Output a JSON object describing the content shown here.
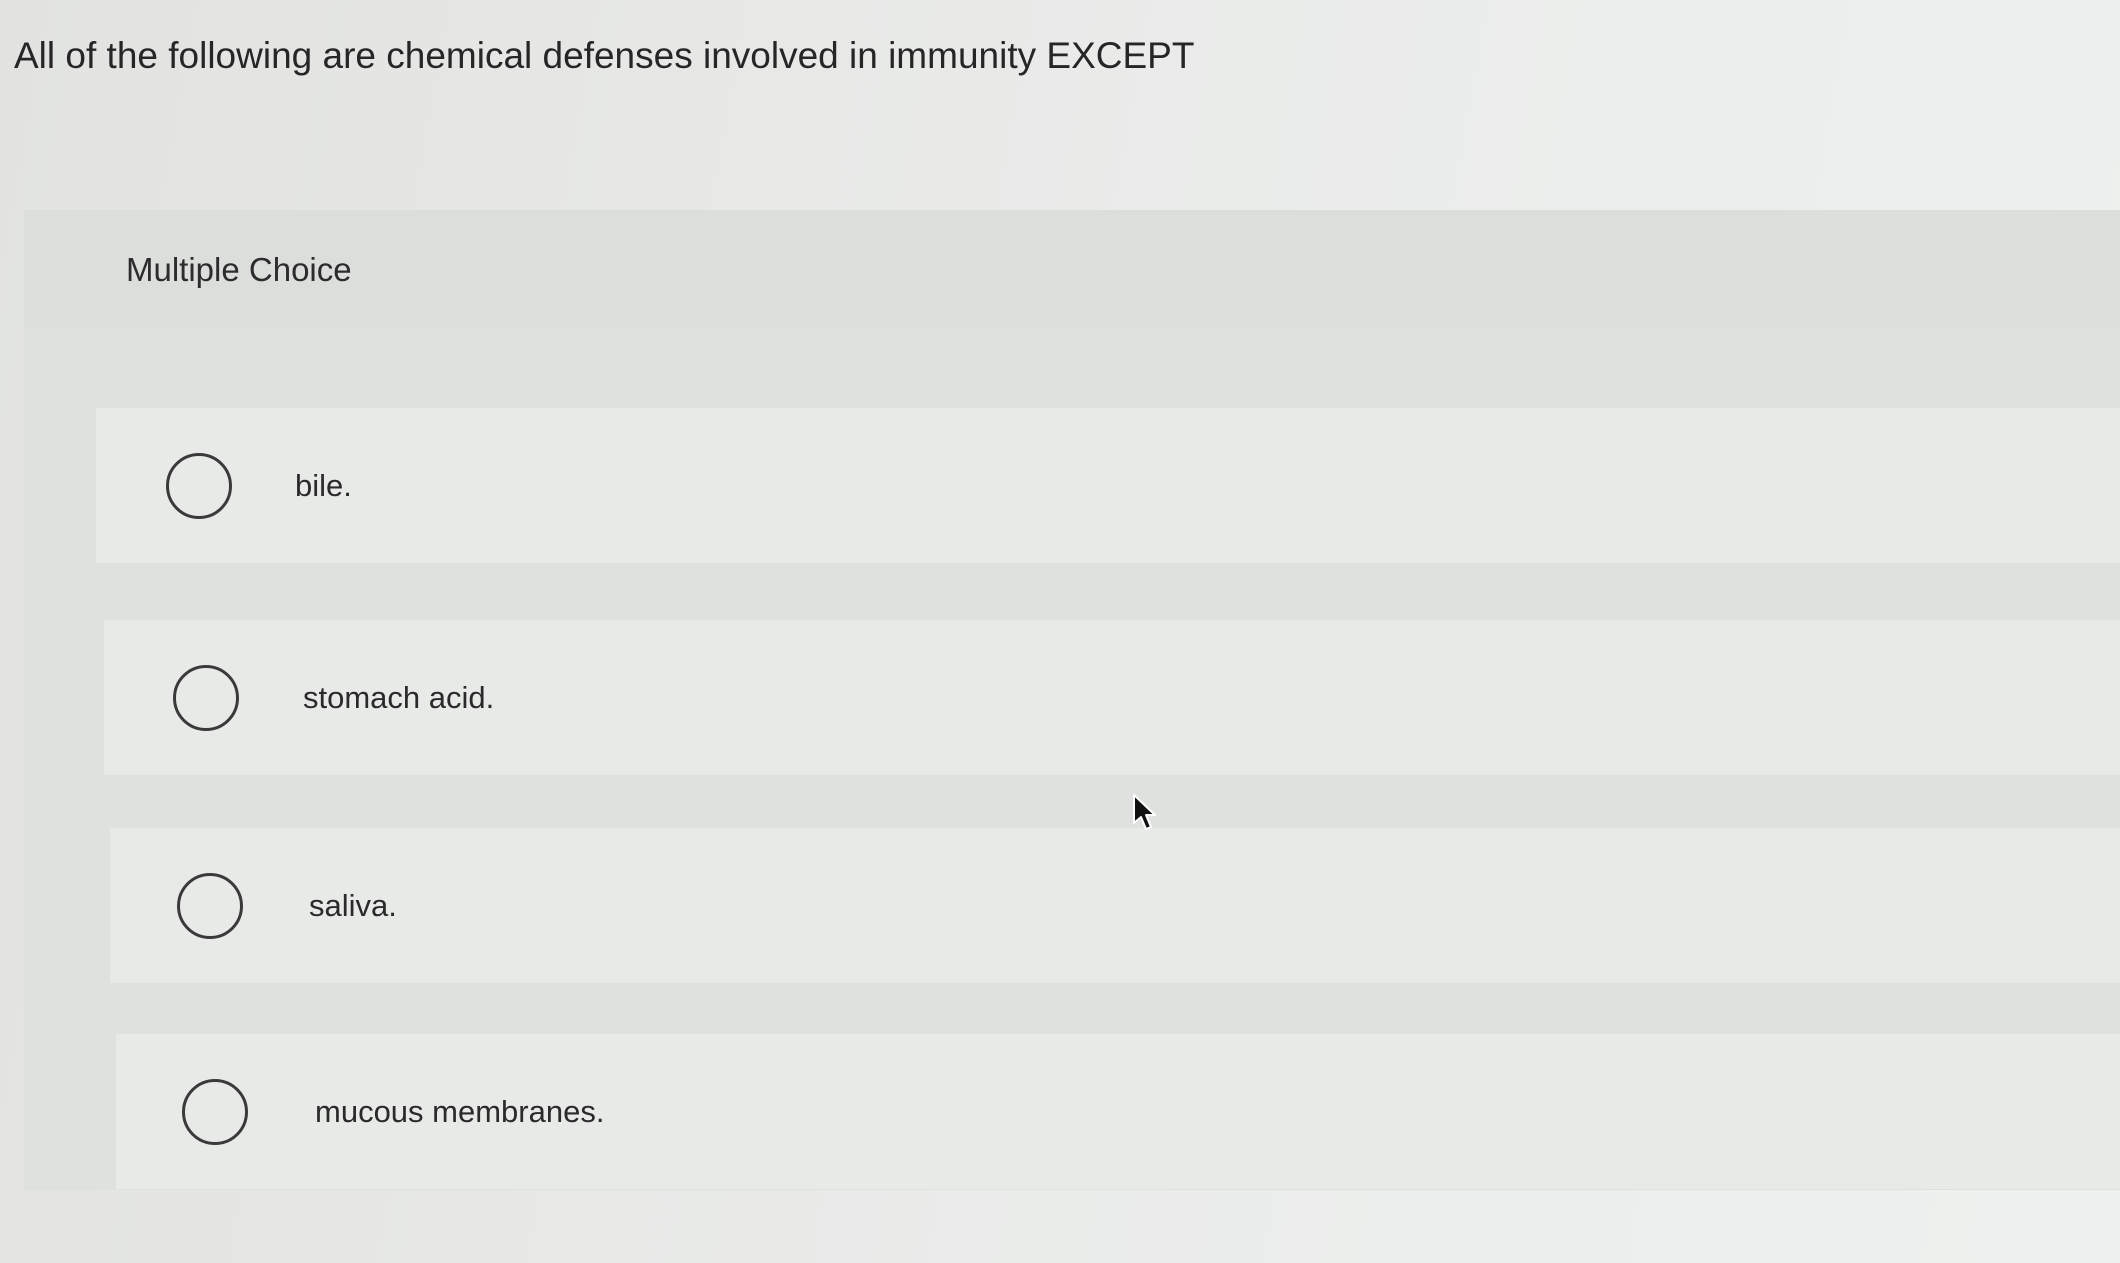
{
  "question": {
    "text": "All of the following are chemical defenses involved in immunity EXCEPT"
  },
  "choices_panel": {
    "label": "Multiple Choice",
    "options": [
      {
        "label": "bile.",
        "selected": false
      },
      {
        "label": "stomach acid.",
        "selected": false
      },
      {
        "label": "saliva.",
        "selected": false
      },
      {
        "label": "mucous membranes.",
        "selected": false
      }
    ]
  },
  "icons": {
    "radio": "radio-button-icon",
    "cursor": "mouse-pointer-icon"
  },
  "colors": {
    "text": "#262626",
    "panel_background": "#dfe1df",
    "option_background": "#e8eae8",
    "radio_border": "#3a3a3a"
  }
}
